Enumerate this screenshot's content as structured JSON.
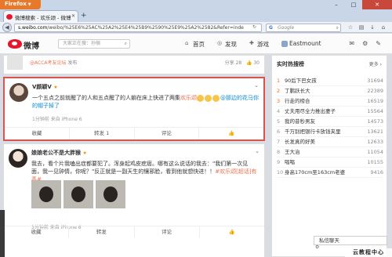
{
  "browser": {
    "app_button": "Firefox",
    "tab_title": "微博搜索 - 欢乐颂 - 微博",
    "url_domain": "s.weibo.com",
    "url_path": "/weibo/%25E6%25AC%25A2%25E4%25B9%2590%25E9%25A2%2582&Refer=inde",
    "search_placeholder": "Google",
    "search_engine_letter": "G"
  },
  "weibo_header": {
    "logo_text": "微博",
    "search_placeholder": "大家正在搜：孙俪",
    "nav": [
      {
        "label": "首页"
      },
      {
        "label": "发现"
      },
      {
        "label": "游戏"
      },
      {
        "label": "Eastmount"
      }
    ]
  },
  "feed": {
    "partial_post": {
      "source_prefix": "@ACCA考友论坛",
      "source_suffix": "发布",
      "share_count": "分享 28",
      "like_count": "30"
    },
    "posts": [
      {
        "user": "V颜颖V",
        "text_main": "一个五点之前就醒了的人和五点醒了的人躺在床上快进了两集",
        "link": "欢乐颂",
        "text_tail": "@那边的花马你的帽子掉了",
        "meta": "1分钟前 来自 iPhone 6",
        "actions": {
          "fav": "收藏",
          "repost": "转发 1",
          "comment": "评论"
        }
      },
      {
        "user": "娘娘老公不是大胖猴",
        "text_main": "我去，看个片我嗑出症都要犯了。浑身起鸡皮疙瘩。哪有这么说话的我去：\"我们第一次见面，我一见钟情，你呢？\"反正就是一副天生的镶邪脸，看到他就想快进！！",
        "link": "#欢乐颂[超话]有毒#",
        "meta": "3分钟前 来自 iPhone 6",
        "actions": {
          "fav": "收藏",
          "repost": "转发",
          "comment": "评论"
        }
      }
    ]
  },
  "sidebar": {
    "title": "实时热搜榜",
    "more": "更多 ›",
    "items": [
      {
        "rank": "1",
        "label": "90后下巴女孩",
        "count": "31694"
      },
      {
        "rank": "2",
        "label": "丁鹏跃长大",
        "count": "22389"
      },
      {
        "rank": "3",
        "label": "行走的榜合",
        "count": "16519"
      },
      {
        "rank": "4",
        "label": "丈夫用尽全力推出妻子",
        "count": "15564"
      },
      {
        "rank": "5",
        "label": "我的昔秒男友",
        "count": "14573"
      },
      {
        "rank": "6",
        "label": "千万别把银行卡放钱夹里",
        "count": "13621"
      },
      {
        "rank": "7",
        "label": "长发真的好美",
        "count": "12633"
      },
      {
        "rank": "8",
        "label": "王大治",
        "count": "11054"
      },
      {
        "rank": "9",
        "label": "唱唱",
        "count": "10155"
      },
      {
        "rank": "10",
        "label": "身高170cm至163cm老婆",
        "count": "9416"
      }
    ]
  },
  "footer": {
    "chat": "私信聊天",
    "watermark": "云教程中心"
  }
}
